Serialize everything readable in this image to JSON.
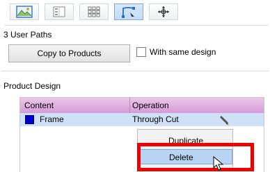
{
  "toolbar": {
    "buttons": [
      {
        "icon": "image-edit-icon",
        "active": false
      },
      {
        "icon": "panel-layout-icon",
        "active": false
      },
      {
        "icon": "grid-icon",
        "active": false
      },
      {
        "icon": "path-node-icon",
        "active": true
      },
      {
        "icon": "crosshair-icon",
        "active": false
      }
    ]
  },
  "user_paths": {
    "title": "3 User Paths",
    "copy_button": "Copy to Products",
    "checkbox_label": "With same design",
    "checkbox_checked": false
  },
  "product_design": {
    "title": "Product Design",
    "columns": [
      "Content",
      "Operation"
    ],
    "rows": [
      {
        "content": "Frame",
        "operation": "Through Cut",
        "color": "#0000cc"
      }
    ]
  },
  "context_menu": {
    "items": [
      {
        "label": "Duplicate",
        "selected": false
      },
      {
        "label": "Delete",
        "selected": true
      }
    ]
  },
  "colors": {
    "header": "#d79bd7",
    "row_highlight": "#cfe1f7",
    "callout": "#ee0000"
  }
}
